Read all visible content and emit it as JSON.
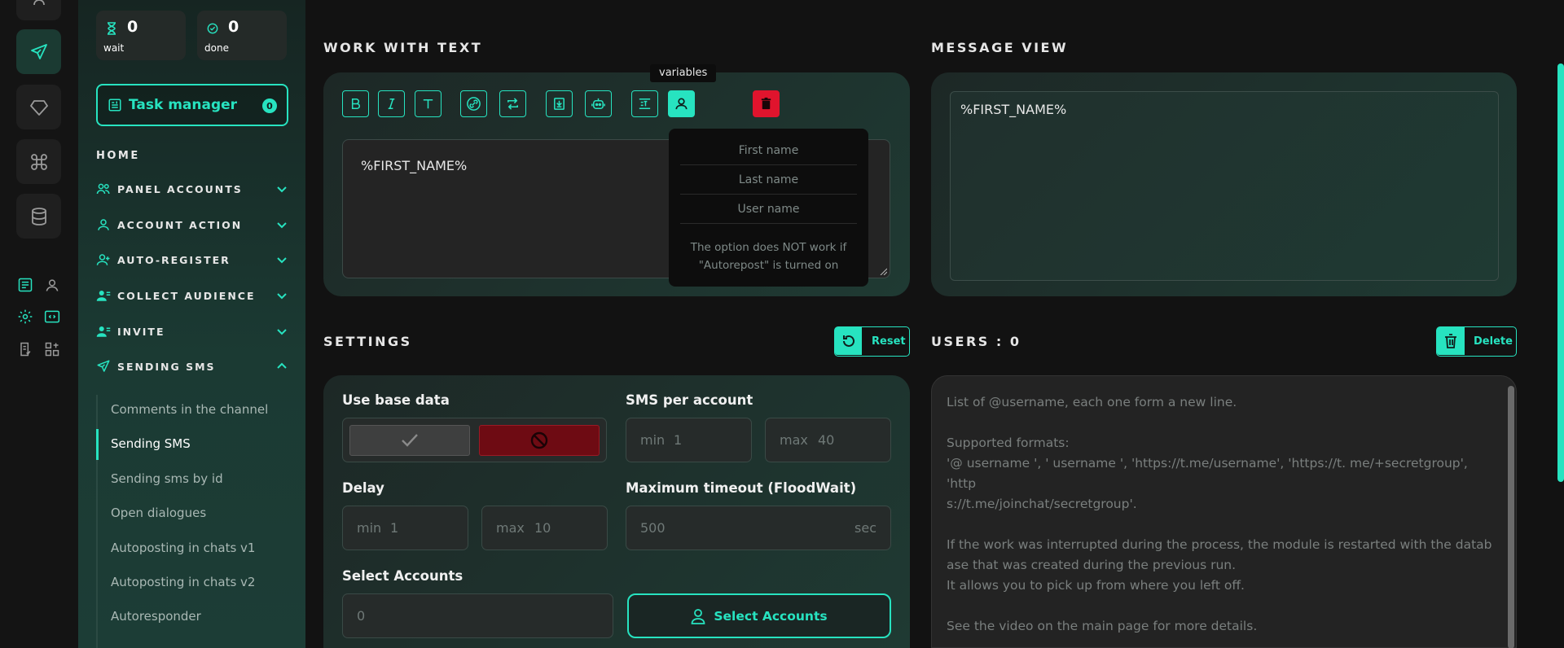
{
  "stats": {
    "wait": {
      "value": "0",
      "label": "wait"
    },
    "done": {
      "value": "0",
      "label": "done"
    }
  },
  "task_manager": {
    "label": "Task manager",
    "count": "0"
  },
  "home_label": "HOME",
  "nav": [
    {
      "label": "PANEL ACCOUNTS",
      "icon": "users-icon"
    },
    {
      "label": "ACCOUNT ACTION",
      "icon": "user-icon"
    },
    {
      "label": "AUTO-REGISTER",
      "icon": "user-plus-icon"
    },
    {
      "label": "COLLECT AUDIENCE",
      "icon": "user-list-icon"
    },
    {
      "label": "INVITE",
      "icon": "user-list-icon"
    },
    {
      "label": "SENDING SMS",
      "icon": "send-icon"
    }
  ],
  "sub_items": [
    "Comments in the channel",
    "Sending SMS",
    "Sending sms by id",
    "Open dialogues",
    "Autoposting in chats v1",
    "Autoposting in chats v2",
    "Autoresponder"
  ],
  "work_with_text": {
    "title": "WORK WITH TEXT",
    "tooltip": "variables",
    "text_value": "%FIRST_NAME%",
    "variables": [
      "First name",
      "Last name",
      "User name"
    ],
    "note": "The option does NOT work if \"Autorepost\" is turned on"
  },
  "message_view": {
    "title": "MESSAGE VIEW",
    "text": "%FIRST_NAME%"
  },
  "settings": {
    "title": "SETTINGS",
    "reset_label": "Reset",
    "use_base_data_label": "Use base data",
    "sms_per_account_label": "SMS per account",
    "sms_min_prefix": "min",
    "sms_min_value": "1",
    "sms_max_prefix": "max",
    "sms_max_value": "40",
    "delay_label": "Delay",
    "delay_min_prefix": "min",
    "delay_min_value": "1",
    "delay_max_prefix": "max",
    "delay_max_value": "10",
    "timeout_label": "Maximum timeout (FloodWait)",
    "timeout_value": "500",
    "timeout_unit": "sec",
    "select_accounts_label": "Select Accounts",
    "select_accounts_value": "0",
    "select_accounts_button": "Select Accounts"
  },
  "users": {
    "title": "USERS : 0",
    "delete_label": "Delete",
    "placeholder": "List of @username, each one form a new line.\n\nSupported formats:\n'@ username ', ' username ', 'https://t.me/username', 'https://t. me/+secretgroup', 'http\ns://t.me/joinchat/secretgroup'.\n\nIf the work was interrupted during the process, the module is restarted with the datab\nase that was created during the previous run.\nIt allows you to pick up from where you left off.\n\nSee the video on the main page for more details."
  },
  "colors": {
    "accent": "#27e3c0",
    "danger": "#e0142d",
    "background": "#121212"
  }
}
